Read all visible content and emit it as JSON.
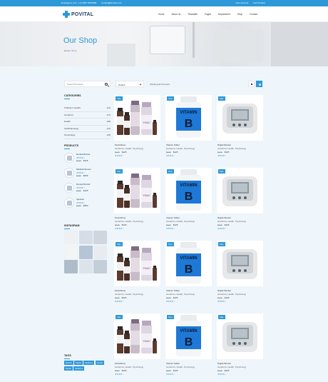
{
  "topbar": {
    "emergency": "Emergency Line : (+1) 987-786-6556",
    "email": "contact@domain.com",
    "account": "User Account",
    "cart": "Cart (5 Item)"
  },
  "header": {
    "logo": "POVITAL",
    "nav": [
      "Home",
      "About us",
      "Timetable",
      "Pages",
      "Department",
      "Shop",
      "Contact"
    ]
  },
  "hero": {
    "title": "Our Shop",
    "breadcrumb_home": "Home",
    "breadcrumb_sep": "/",
    "breadcrumb_current": "Shop"
  },
  "sidebar": {
    "search_placeholder": "Search Products...",
    "categories_title": "CATEGORIES",
    "categories": [
      {
        "name": "Children's Health",
        "count": "(21)"
      },
      {
        "name": "Geriatrics",
        "count": "(17)"
      },
      {
        "name": "Health",
        "count": "(29)"
      },
      {
        "name": "Ophthalmology",
        "count": "(12)"
      },
      {
        "name": "Psychology",
        "count": "(15)"
      }
    ],
    "products_title": "PRODUCTS",
    "products": [
      {
        "name": "Dental Monitor",
        "old": "$149",
        "new": "$125",
        "rating": 4
      },
      {
        "name": "Medical Gloves",
        "old": "$179",
        "new": "$299",
        "rating": 4
      },
      {
        "name": "Dental Monitor",
        "old": "$179",
        "new": "$125",
        "rating": 4
      },
      {
        "name": "Injection",
        "old": "$170",
        "new": "$360",
        "rating": 4
      }
    ],
    "instagram_title": "INSTAGRAM",
    "instagram_colors": [
      "#eef0f3",
      "#d6dde6",
      "#cfd6de",
      "#f2f4f6",
      "#b5c4d6",
      "#e8ecf1",
      "#aebbc9",
      "#dce3ea",
      "#c4ced9"
    ],
    "tags_title": "TAGS",
    "tags": [
      "Dentist",
      "Digital",
      "Medicine",
      "Dentist",
      "Digital",
      "Medicine"
    ]
  },
  "toolbar": {
    "sort_value": "Default",
    "showing": "Showing all 10 result"
  },
  "products": [
    {
      "badge": "Sale",
      "name": "Perdoblime",
      "cats": "Geriatrics, Health, Psychology",
      "old": "$149",
      "new": "$125",
      "rating": 4,
      "img": "bottles"
    },
    {
      "badge": "New",
      "name": "Vitamin Tablet",
      "cats": "Geriatrics, Health, Psychology",
      "old": "$149",
      "new": "$125",
      "rating": 4,
      "img": "vitamin"
    },
    {
      "badge": "Sale",
      "name": "Digital Monitor",
      "cats": "Geriatrics, Health, Psychology",
      "old": "$149",
      "new": "$125",
      "rating": 4,
      "img": "monitor"
    },
    {
      "badge": "Sale",
      "name": "Perdoblime",
      "cats": "Geriatrics, Health, Psychology",
      "old": "$149",
      "new": "$125",
      "rating": 4,
      "img": "bottles"
    },
    {
      "badge": "New",
      "name": "Vitamin Tablet",
      "cats": "Geriatrics, Health, Psychology",
      "old": "$149",
      "new": "$125",
      "rating": 4,
      "img": "vitamin"
    },
    {
      "badge": "Sale",
      "name": "Digital Monitor",
      "cats": "Geriatrics, Health, Psychology",
      "old": "$149",
      "new": "$125",
      "rating": 4,
      "img": "monitor"
    },
    {
      "badge": "Sale",
      "name": "Perdoblime",
      "cats": "Geriatrics, Health, Psychology",
      "old": "$149",
      "new": "$125",
      "rating": 4,
      "img": "bottles"
    },
    {
      "badge": "New",
      "name": "Vitamin Tablet",
      "cats": "Geriatrics, Health, Psychology",
      "old": "$149",
      "new": "$125",
      "rating": 4,
      "img": "vitamin"
    },
    {
      "badge": "Sale",
      "name": "Digital Monitor",
      "cats": "Geriatrics, Health, Psychology",
      "old": "$149",
      "new": "$125",
      "rating": 4,
      "img": "monitor"
    },
    {
      "badge": "Sale",
      "name": "Perdoblime",
      "cats": "Geriatrics, Health, Psychology",
      "old": "$149",
      "new": "$125",
      "rating": 4,
      "img": "bottles"
    },
    {
      "badge": "New",
      "name": "Vitamin Tablet",
      "cats": "Geriatrics, Health, Psychology",
      "old": "$149",
      "new": "$125",
      "rating": 4,
      "img": "vitamin"
    },
    {
      "badge": "Sale",
      "name": "Digital Monitor",
      "cats": "Geriatrics, Health, Psychology",
      "old": "$149",
      "new": "$125",
      "rating": 4,
      "img": "monitor"
    }
  ],
  "product_image_text": {
    "vitamin_word": "VITAMIN",
    "vitamin_letter": "B",
    "bottle_label": "YNAC"
  },
  "colors": {
    "accent": "#2d98d8",
    "shop_bg": "#eef5fb",
    "vitamin_label": "#1e78d6"
  }
}
